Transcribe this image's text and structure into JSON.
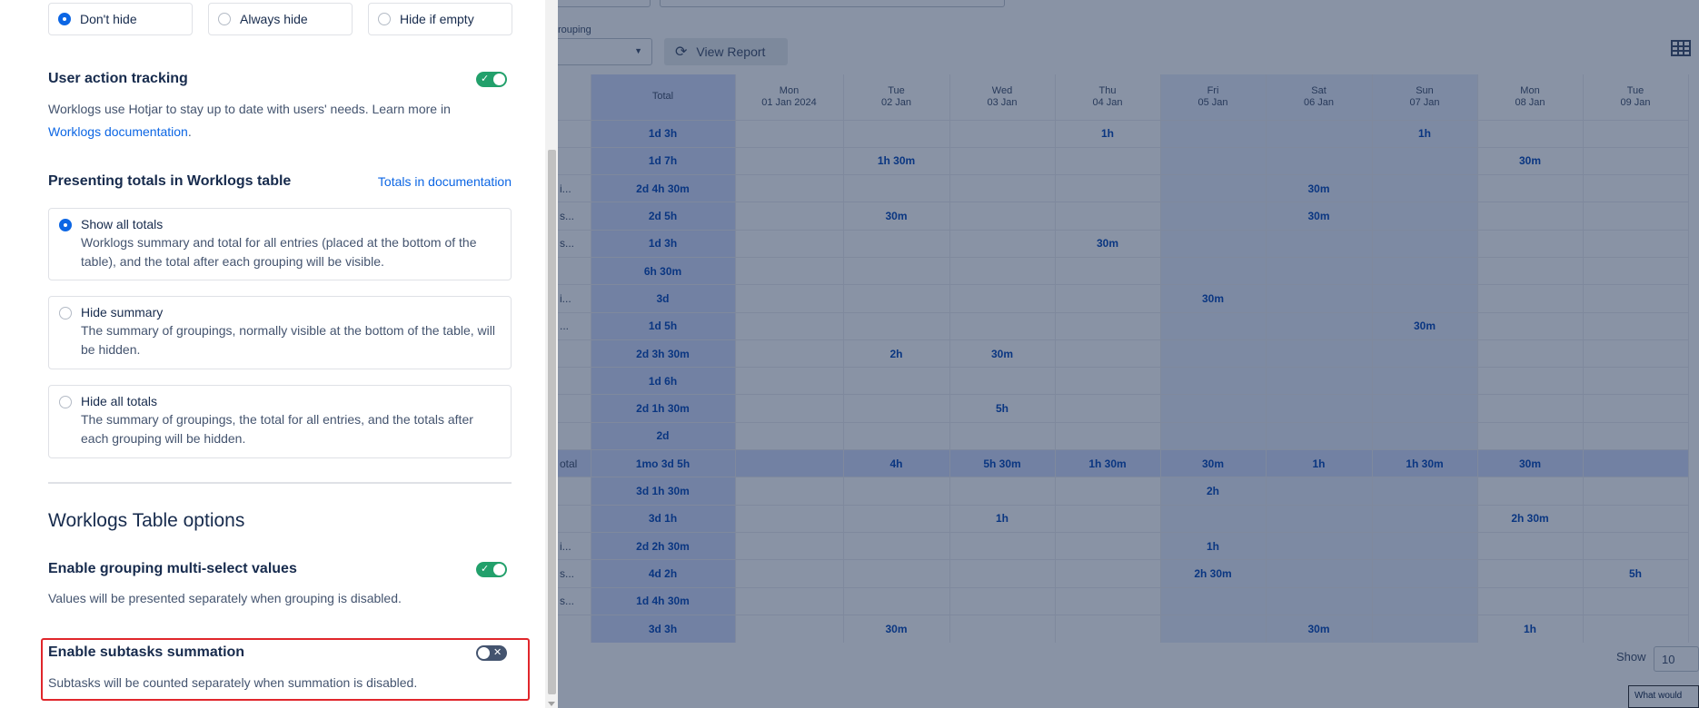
{
  "empty_columns": {
    "options": [
      {
        "label": "Don't hide",
        "checked": true
      },
      {
        "label": "Always hide",
        "checked": false
      },
      {
        "label": "Hide if empty",
        "checked": false
      }
    ]
  },
  "user_action_tracking": {
    "title": "User action tracking",
    "enabled": true,
    "desc_text": "Worklogs use Hotjar to stay up to date with users' needs. Learn more in",
    "link_text": "Worklogs documentation",
    "desc_end": "."
  },
  "totals": {
    "title": "Presenting totals in Worklogs table",
    "doc_link": "Totals in documentation",
    "options": [
      {
        "title": "Show all totals",
        "desc": "Worklogs summary and total for all entries (placed at the bottom of the table), and the total after each grouping will be visible.",
        "checked": true
      },
      {
        "title": "Hide summary",
        "desc": "The summary of groupings, normally visible at the bottom of the table, will be hidden.",
        "checked": false
      },
      {
        "title": "Hide all totals",
        "desc": "The summary of groupings, the total for all entries, and the totals after each grouping will be hidden.",
        "checked": false
      }
    ]
  },
  "table_options": {
    "section_title": "Worklogs Table options",
    "grouping": {
      "title": "Enable grouping multi-select values",
      "desc": "Values will be presented separately when grouping is disabled.",
      "enabled": true
    },
    "subtasks": {
      "title": "Enable subtasks summation",
      "desc": "Subtasks will be counted separately when summation is disabled.",
      "enabled": false
    }
  },
  "report": {
    "grouping_label": "rouping",
    "view_report_label": "View Report",
    "columns": [
      {
        "day": "Total",
        "date": ""
      },
      {
        "day": "Mon",
        "date": "01 Jan 2024"
      },
      {
        "day": "Tue",
        "date": "02 Jan"
      },
      {
        "day": "Wed",
        "date": "03 Jan"
      },
      {
        "day": "Thu",
        "date": "04 Jan"
      },
      {
        "day": "Fri",
        "date": "05 Jan"
      },
      {
        "day": "Sat",
        "date": "06 Jan"
      },
      {
        "day": "Sun",
        "date": "07 Jan"
      },
      {
        "day": "Mon",
        "date": "08 Jan"
      },
      {
        "day": "Tue",
        "date": "09 Jan"
      }
    ],
    "rows": [
      {
        "label": "",
        "cells": [
          "1d 3h",
          "",
          "",
          "",
          "1h",
          "",
          "",
          "1h",
          "",
          ""
        ]
      },
      {
        "label": "",
        "cells": [
          "1d 7h",
          "",
          "1h 30m",
          "",
          "",
          "",
          "",
          "",
          "30m",
          ""
        ]
      },
      {
        "label": "i...",
        "cells": [
          "2d 4h 30m",
          "",
          "",
          "",
          "",
          "",
          "30m",
          "",
          "",
          ""
        ]
      },
      {
        "label": "s...",
        "cells": [
          "2d 5h",
          "",
          "30m",
          "",
          "",
          "",
          "30m",
          "",
          "",
          ""
        ]
      },
      {
        "label": "s...",
        "cells": [
          "1d 3h",
          "",
          "",
          "",
          "30m",
          "",
          "",
          "",
          "",
          ""
        ]
      },
      {
        "label": "",
        "cells": [
          "6h 30m",
          "",
          "",
          "",
          "",
          "",
          "",
          "",
          "",
          ""
        ]
      },
      {
        "label": "i...",
        "cells": [
          "3d",
          "",
          "",
          "",
          "",
          "30m",
          "",
          "",
          "",
          ""
        ]
      },
      {
        "label": "...",
        "cells": [
          "1d 5h",
          "",
          "",
          "",
          "",
          "",
          "",
          "30m",
          "",
          ""
        ]
      },
      {
        "label": "",
        "cells": [
          "2d 3h 30m",
          "",
          "2h",
          "30m",
          "",
          "",
          "",
          "",
          "",
          ""
        ]
      },
      {
        "label": "",
        "cells": [
          "1d 6h",
          "",
          "",
          "",
          "",
          "",
          "",
          "",
          "",
          ""
        ]
      },
      {
        "label": "",
        "cells": [
          "2d 1h 30m",
          "",
          "",
          "5h",
          "",
          "",
          "",
          "",
          "",
          ""
        ]
      },
      {
        "label": "",
        "cells": [
          "2d",
          "",
          "",
          "",
          "",
          "",
          "",
          "",
          "",
          ""
        ]
      },
      {
        "label": "otal",
        "subtotal": true,
        "cells": [
          "1mo 3d 5h",
          "",
          "4h",
          "5h 30m",
          "1h 30m",
          "30m",
          "1h",
          "1h 30m",
          "30m",
          ""
        ]
      },
      {
        "label": "",
        "cells": [
          "3d 1h 30m",
          "",
          "",
          "",
          "",
          "2h",
          "",
          "",
          "",
          ""
        ]
      },
      {
        "label": "",
        "cells": [
          "3d 1h",
          "",
          "",
          "1h",
          "",
          "",
          "",
          "",
          "2h 30m",
          ""
        ]
      },
      {
        "label": "i...",
        "cells": [
          "2d 2h 30m",
          "",
          "",
          "",
          "",
          "1h",
          "",
          "",
          "",
          ""
        ]
      },
      {
        "label": "s...",
        "cells": [
          "4d 2h",
          "",
          "",
          "",
          "",
          "2h 30m",
          "",
          "",
          "",
          "5h"
        ]
      },
      {
        "label": "s...",
        "cells": [
          "1d 4h 30m",
          "",
          "",
          "",
          "",
          "",
          "",
          "",
          "",
          ""
        ]
      },
      {
        "label": "",
        "cells": [
          "3d 3h",
          "",
          "30m",
          "",
          "",
          "",
          "30m",
          "",
          "1h",
          ""
        ]
      }
    ],
    "show_label": "Show",
    "show_value": "10",
    "help_text": "What would"
  },
  "colors": {
    "accent": "#0c66e4",
    "toggle_on": "#22a06b",
    "toggle_off": "#44546f",
    "highlight": "#e0262b"
  }
}
